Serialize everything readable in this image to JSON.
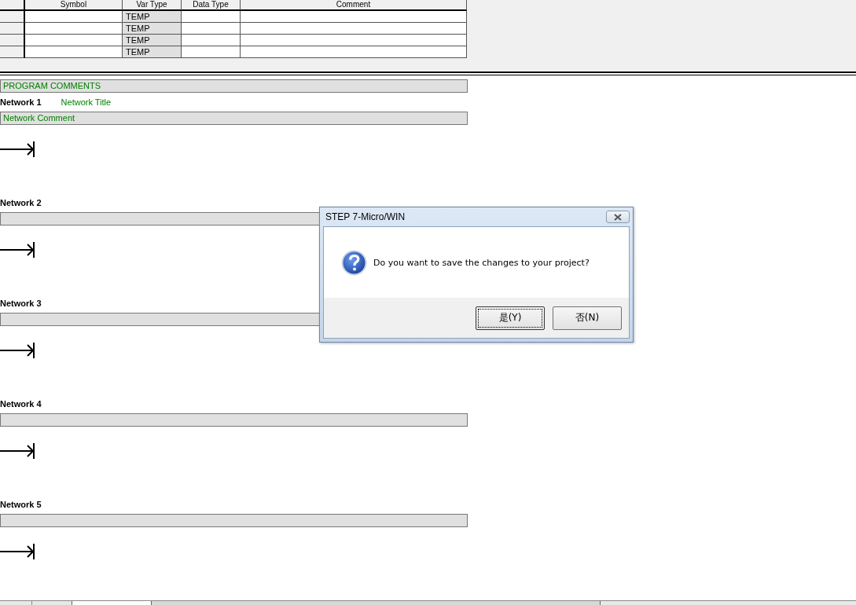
{
  "variable_table": {
    "columns": [
      "Symbol",
      "Var Type",
      "Data Type",
      "Comment"
    ],
    "rows": [
      {
        "var_type": "TEMP"
      },
      {
        "var_type": "TEMP"
      },
      {
        "var_type": "TEMP"
      },
      {
        "var_type": "TEMP"
      }
    ]
  },
  "program_comments": "PROGRAM COMMENTS",
  "networks": [
    {
      "label": "Network 1",
      "title": "Network Title",
      "comment": "Network Comment"
    },
    {
      "label": "Network 2"
    },
    {
      "label": "Network 3"
    },
    {
      "label": "Network 4"
    },
    {
      "label": "Network 5"
    }
  ],
  "dialog": {
    "title": "STEP 7-Micro/WIN",
    "message": "Do you want to save the changes to your project?",
    "buttons": [
      {
        "label": "是(Y)",
        "default": true
      },
      {
        "label": "否(N)",
        "default": false
      }
    ]
  }
}
